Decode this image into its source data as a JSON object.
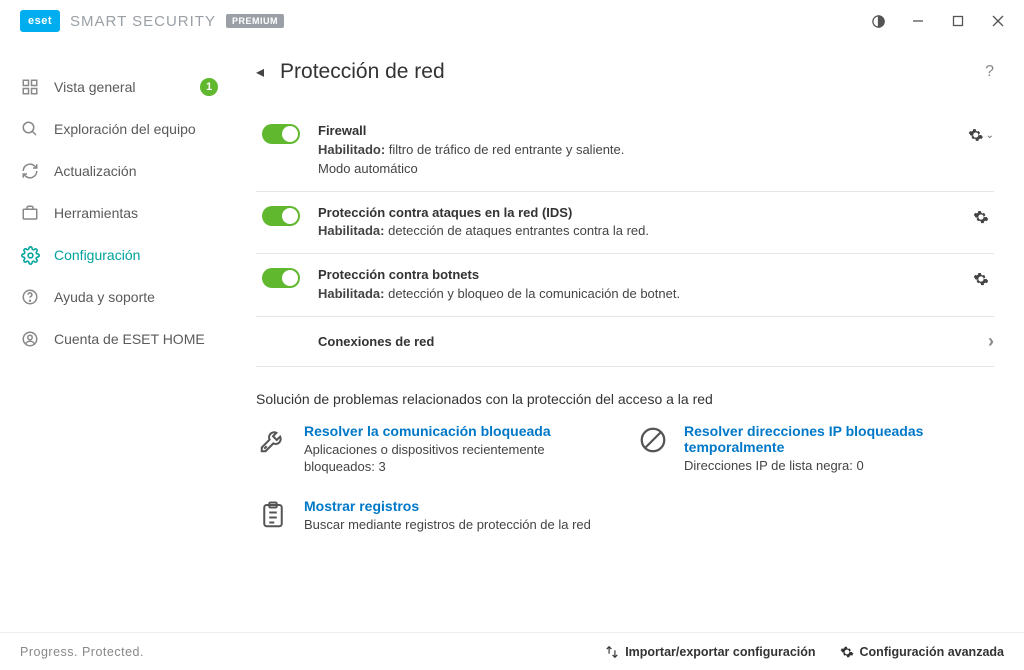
{
  "brand": {
    "logo": "eset",
    "product": "SMART SECURITY",
    "badge": "PREMIUM"
  },
  "nav": {
    "items": [
      {
        "label": "Vista general",
        "badge": "1"
      },
      {
        "label": "Exploración del equipo"
      },
      {
        "label": "Actualización"
      },
      {
        "label": "Herramientas"
      },
      {
        "label": "Configuración"
      },
      {
        "label": "Ayuda y soporte"
      },
      {
        "label": "Cuenta de ESET HOME"
      }
    ]
  },
  "page": {
    "title": "Protección de red",
    "modules": [
      {
        "title": "Firewall",
        "status_label": "Habilitado:",
        "status_text": "filtro de tráfico de red entrante y saliente.",
        "extra": "Modo automático",
        "gear_chevron": true
      },
      {
        "title": "Protección contra ataques en la red (IDS)",
        "status_label": "Habilitada:",
        "status_text": "detección de ataques entrantes contra la red.",
        "extra": "",
        "gear_chevron": false
      },
      {
        "title": "Protección contra botnets",
        "status_label": "Habilitada:",
        "status_text": "detección y bloqueo de la comunicación de botnet.",
        "extra": "",
        "gear_chevron": false
      }
    ],
    "link_row": "Conexiones de red",
    "section_heading": "Solución de problemas relacionados con la protección del acceso a la red",
    "cards": [
      {
        "title": "Resolver la comunicación bloqueada",
        "desc": "Aplicaciones o dispositivos recientemente bloqueados: 3"
      },
      {
        "title": "Resolver direcciones IP bloqueadas temporalmente",
        "desc": "Direcciones IP de lista negra: 0"
      },
      {
        "title": "Mostrar registros",
        "desc": "Buscar mediante registros de protección de la red"
      }
    ],
    "footer": {
      "tagline": "Progress. Protected.",
      "import_export": "Importar/exportar configuración",
      "advanced": "Configuración avanzada"
    }
  }
}
